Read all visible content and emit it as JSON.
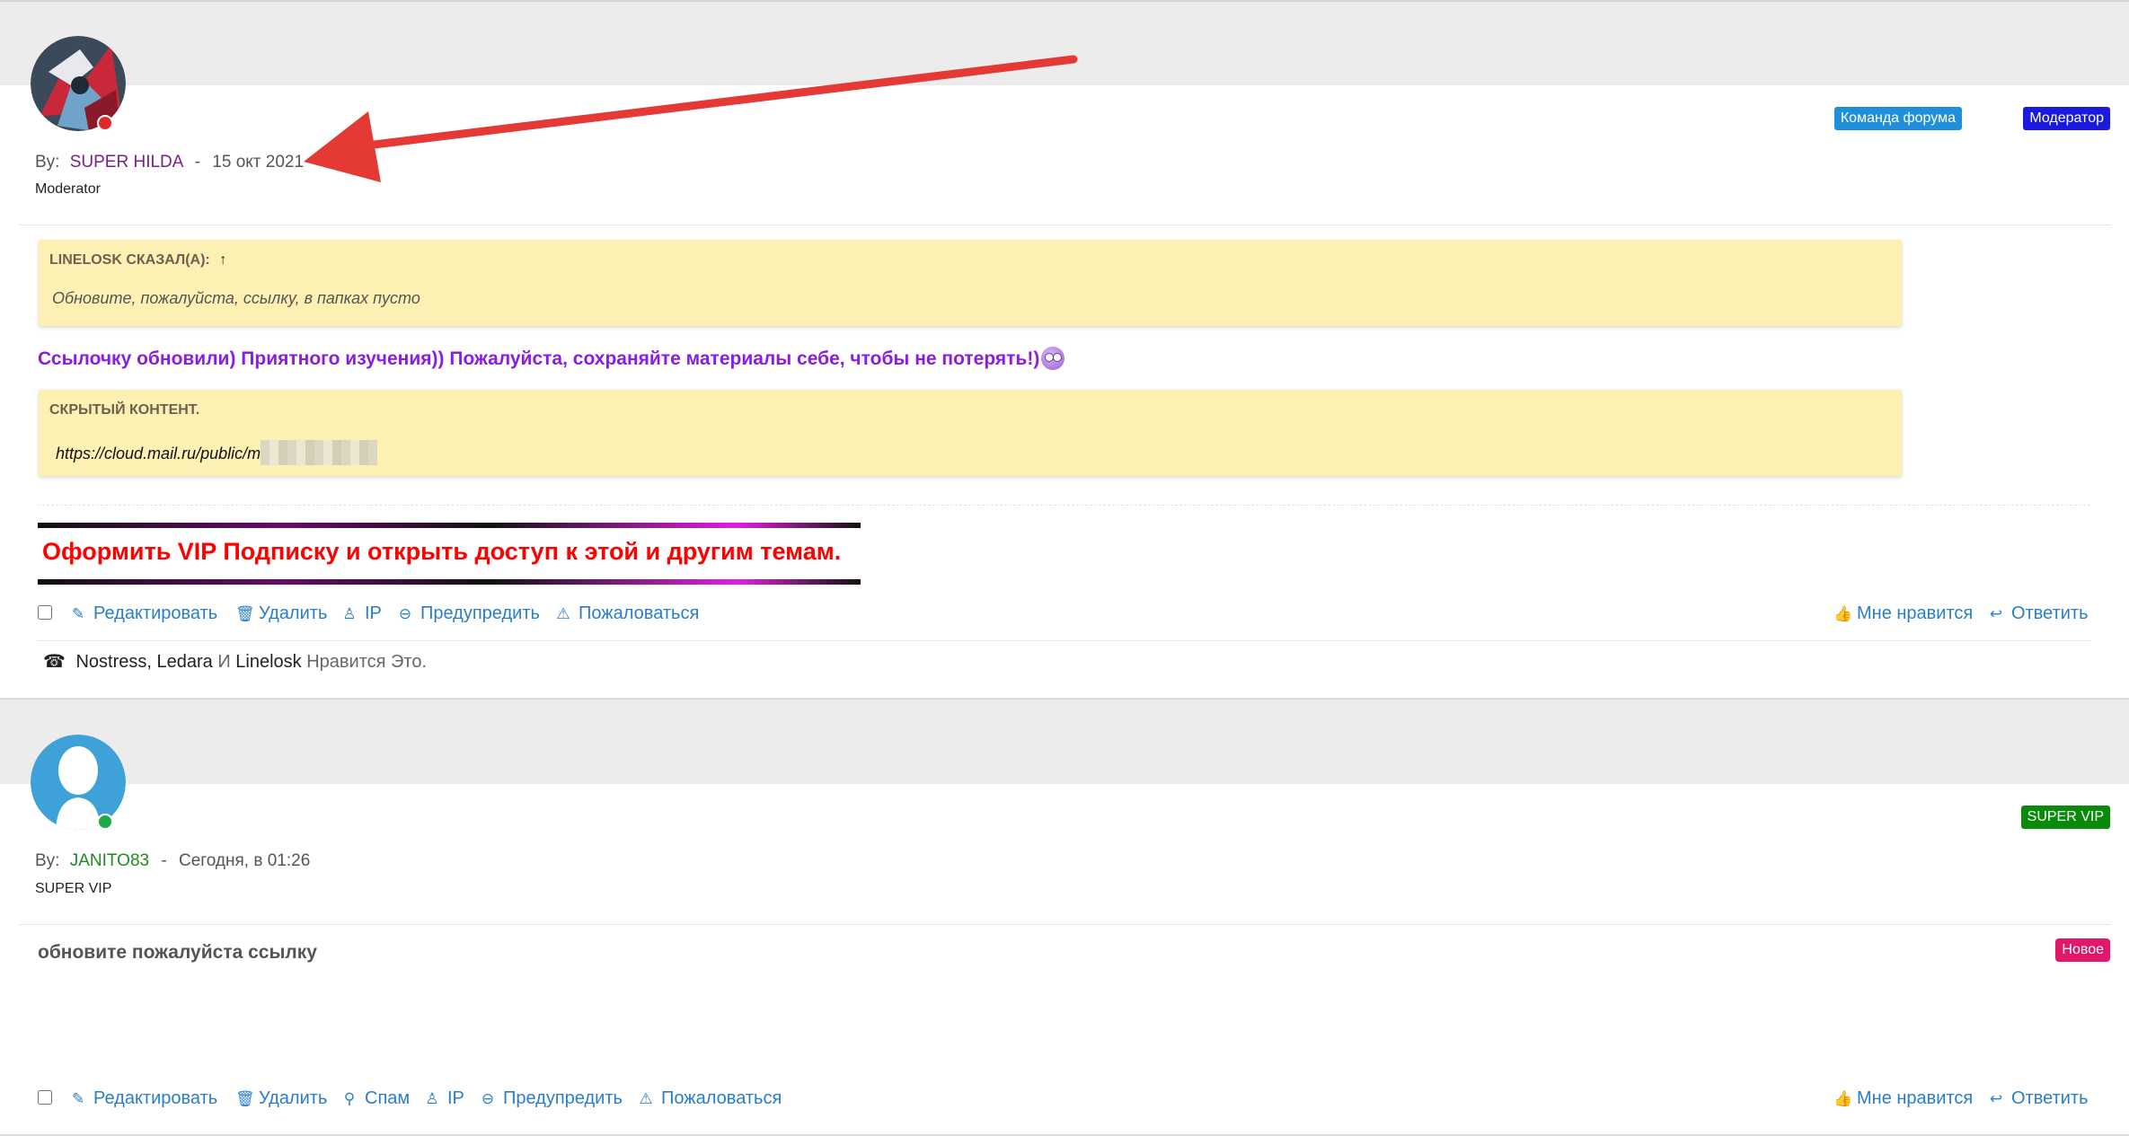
{
  "colors": {
    "link": "#2a7ec8",
    "username_purple": "#7b1d8a",
    "username_green": "#1f8a1f",
    "badge_team": "#1f8fdc",
    "badge_moderator": "#1a1adf",
    "badge_supervip": "#0a8a0a",
    "badge_new": "#e0186c",
    "quote_bg": "#fdf0b3",
    "arrow": "#e53935"
  },
  "post1": {
    "by_label": "By:",
    "username": "SUPER HILDA",
    "date": "15 окт 2021",
    "user_title": "Moderator",
    "badges": [
      "Команда форума",
      "Модератор"
    ],
    "quote": {
      "author": "LINELOSK СКАЗАЛ(А):",
      "arrow_glyph": "↑",
      "text": "Обновите, пожалуйста, ссылку, в папках пусто"
    },
    "message": "Ссылочку обновили) Приятного изучения)) Пожалуйста, сохраняйте материалы себе, чтобы не потерять!)",
    "hidden": {
      "title": "СКРЫТЫЙ КОНТЕНТ.",
      "link": "https://cloud.mail.ru/public/m"
    },
    "vip_banner": "Оформить VIP Подписку и открыть доступ к этой и другим темам.",
    "actions": {
      "edit": "Редактировать",
      "delete": "Удалить",
      "ip": "IP",
      "warn": "Предупредить",
      "report": "Пожаловаться",
      "like": "Мне нравится",
      "reply": "Ответить"
    },
    "likes": {
      "names": "Nostress, Ledara",
      "and": "И",
      "last": "Linelosk",
      "suffix": "Нравится Это."
    }
  },
  "post2": {
    "by_label": "By:",
    "username": "JANITO83",
    "date": "Сегодня, в 01:26",
    "user_title": "SUPER VIP",
    "badge": "SUPER VIP",
    "new_badge": "Новое",
    "message": "обновите пожалуйста ссылку",
    "actions": {
      "edit": "Редактировать",
      "delete": "Удалить",
      "spam": "Спам",
      "ip": "IP",
      "warn": "Предупредить",
      "report": "Пожаловаться",
      "like": "Мне нравится",
      "reply": "Ответить"
    }
  },
  "icons": {
    "edit": "edit-icon",
    "delete": "trash-icon",
    "ip": "user-ip-icon",
    "warn": "minus-circle-icon",
    "report": "warning-triangle-icon",
    "like": "thumbs-up-icon",
    "reply": "reply-icon",
    "spam": "spam-user-icon",
    "likes": "phone-icon"
  }
}
